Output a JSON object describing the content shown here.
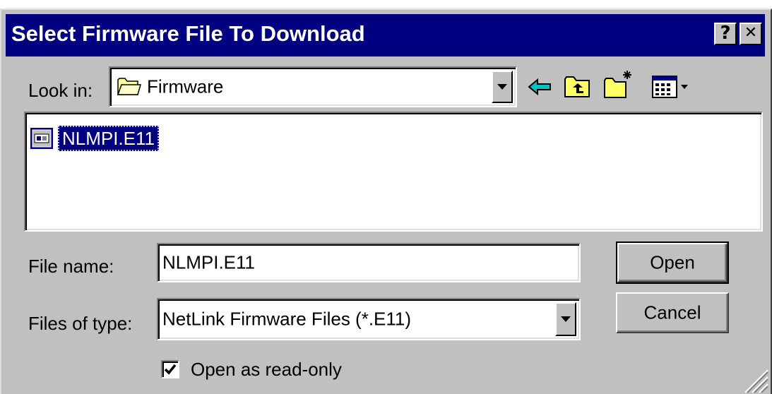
{
  "dialog": {
    "title": "Select Firmware File To Download",
    "help_button": "?",
    "close_button": "✕"
  },
  "look_in": {
    "label": "Look in:",
    "value": "Firmware",
    "folder_icon": "folder-icon"
  },
  "toolbar": {
    "back_icon": "back-arrow-icon",
    "up_icon": "up-one-level-icon",
    "new_folder_icon": "new-folder-icon",
    "view_icon": "view-menu-icon"
  },
  "file_list": {
    "items": [
      {
        "name": "NLMPI.E11",
        "icon": "firmware-file-icon",
        "selected": true
      }
    ]
  },
  "file_name": {
    "label": "File name:",
    "value": "NLMPI.E11"
  },
  "file_type": {
    "label": "Files of type:",
    "value": "NetLink Firmware Files (*.E11)"
  },
  "buttons": {
    "open": "Open",
    "cancel": "Cancel"
  },
  "read_only": {
    "label": "Open as read-only",
    "checked": true
  },
  "colors": {
    "title_bar": "#000080",
    "face": "#c0c0c0",
    "selection": "#000080",
    "back_arrow": "#00c0c0"
  }
}
